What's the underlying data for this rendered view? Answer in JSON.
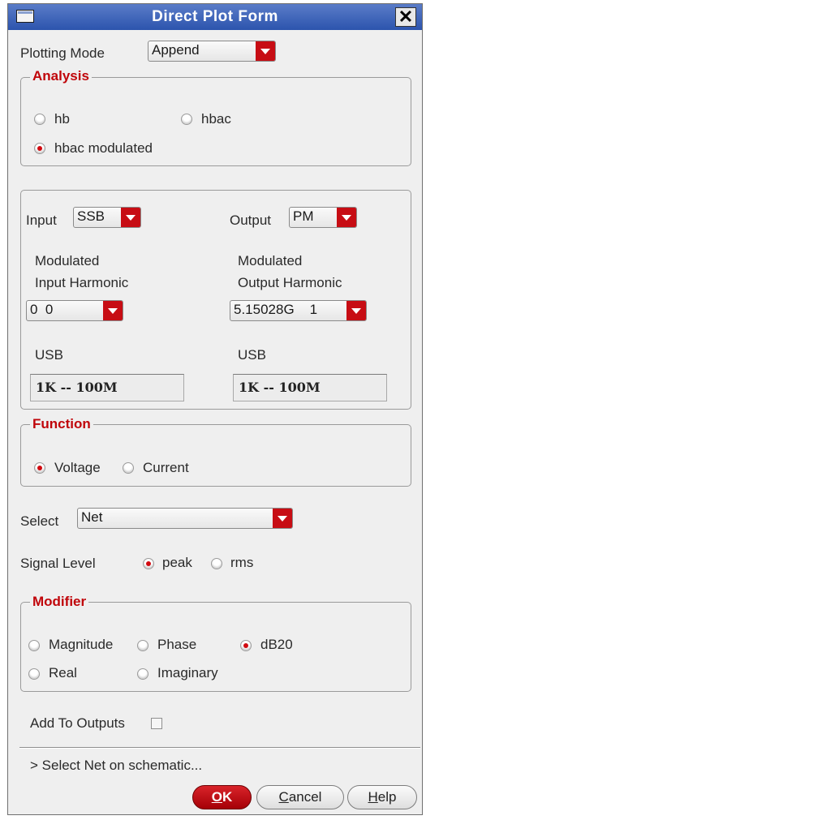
{
  "window": {
    "title": "Direct Plot Form"
  },
  "plotting_mode": {
    "label": "Plotting Mode",
    "value": "Append"
  },
  "analysis": {
    "title": "Analysis",
    "hb": "hb",
    "hbac": "hbac",
    "hbac_modulated": "hbac modulated",
    "selected": "hbac modulated"
  },
  "io": {
    "input_label": "Input",
    "input_value": "SSB",
    "output_label": "Output",
    "output_value": "PM",
    "input_harm_line1": "Modulated",
    "input_harm_line2": "Input Harmonic",
    "output_harm_line1": "Modulated",
    "output_harm_line2": "Output Harmonic",
    "input_harm_value": "0  0",
    "output_harm_value": "5.15028G    1",
    "input_usb": "USB",
    "output_usb": "USB",
    "input_range": "1K -- 100M",
    "output_range": "1K -- 100M"
  },
  "function": {
    "title": "Function",
    "voltage": "Voltage",
    "current": "Current",
    "selected": "Voltage"
  },
  "select": {
    "label": "Select",
    "value": "Net"
  },
  "signal_level": {
    "label": "Signal Level",
    "peak": "peak",
    "rms": "rms",
    "selected": "peak"
  },
  "modifier": {
    "title": "Modifier",
    "magnitude": "Magnitude",
    "phase": "Phase",
    "db20": "dB20",
    "real": "Real",
    "imaginary": "Imaginary",
    "selected": "dB20"
  },
  "add_to_outputs": {
    "label": "Add To Outputs",
    "checked": false
  },
  "status": {
    "text": "> Select Net on schematic..."
  },
  "buttons": {
    "ok_mnemonic": "O",
    "ok_rest": "K",
    "cancel_mnemonic": "C",
    "cancel_rest": "ancel",
    "help_mnemonic": "H",
    "help_rest": "elp"
  },
  "colors": {
    "title_bar": "#2c54ad",
    "accent_red": "#c70d14",
    "group_title": "#c0050a",
    "dialog_bg": "#efefef"
  }
}
